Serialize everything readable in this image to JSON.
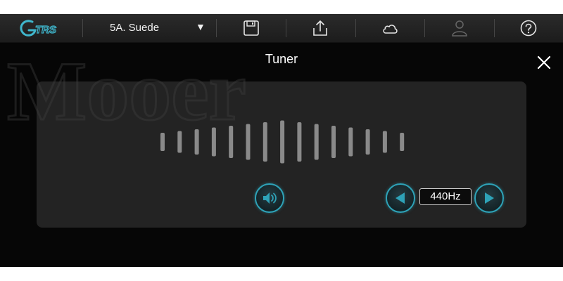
{
  "toolbar": {
    "logo_text": "GTRS",
    "preset_name": "5A. Suede",
    "preset_arrow": "▼",
    "icons": [
      "save-icon",
      "upload-icon",
      "cloud-icon",
      "user-icon",
      "help-icon"
    ]
  },
  "dialog": {
    "title": "Tuner",
    "close_icon": "close-icon"
  },
  "tuner": {
    "reference_frequency": "440Hz",
    "sound_icon": "speaker-icon",
    "decrease_icon": "triangle-left-icon",
    "increase_icon": "triangle-right-icon",
    "accent_color": "#2ea3b8"
  },
  "background_watermark": "Mooer"
}
